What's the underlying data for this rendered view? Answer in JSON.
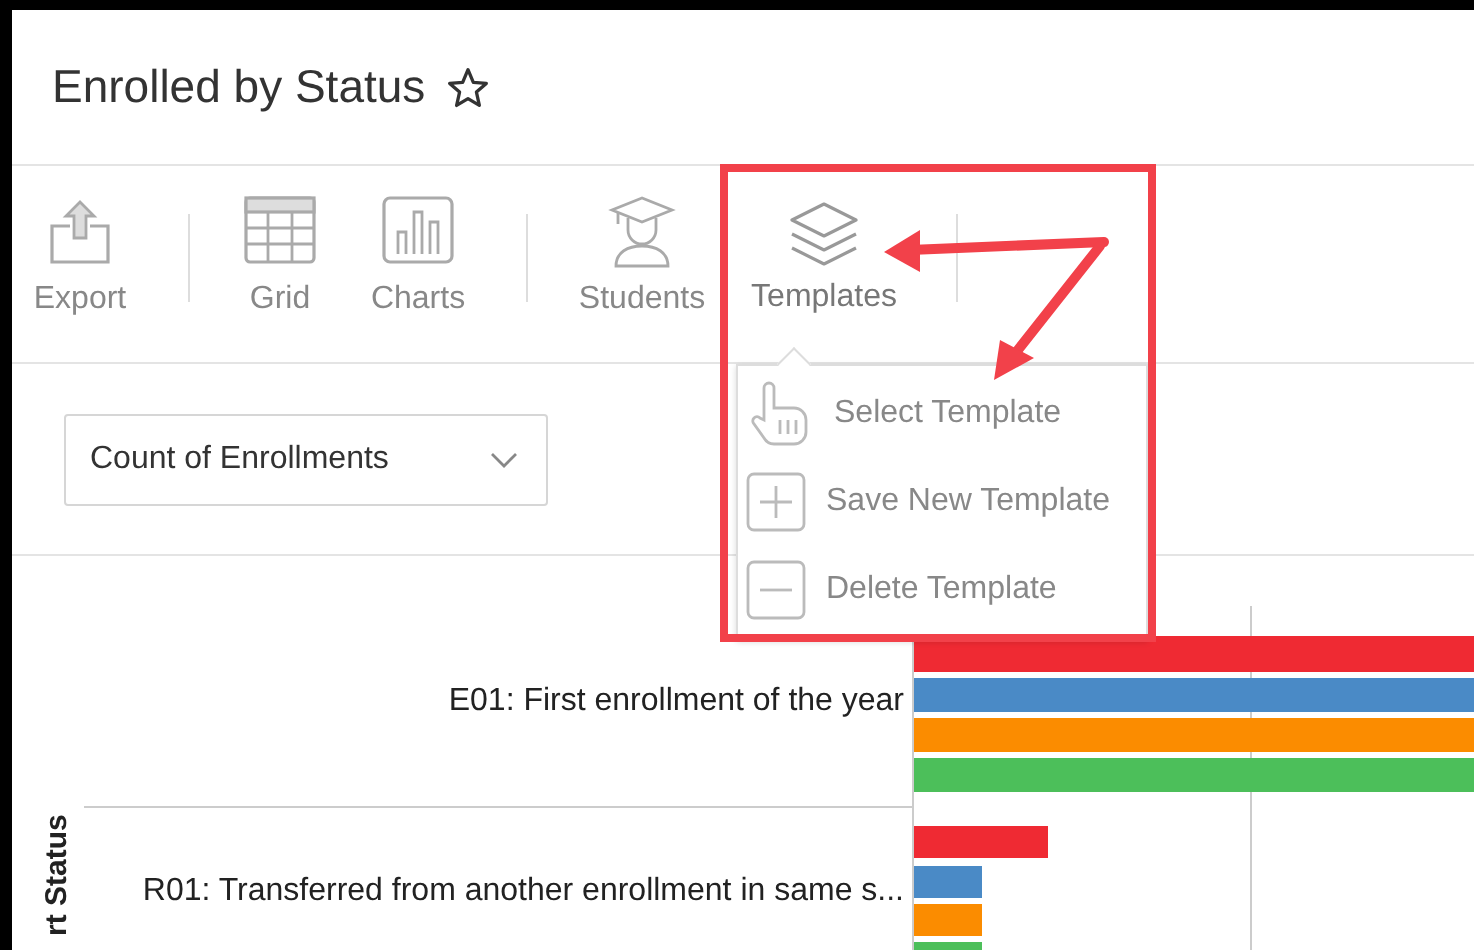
{
  "window": {
    "title": "Enrolled by Status",
    "favorite": false
  },
  "toolbar": [
    {
      "kind": "export",
      "label": "Export",
      "expanded": false
    },
    {
      "kind": "separator"
    },
    {
      "kind": "grid",
      "label": "Grid",
      "expanded": false
    },
    {
      "kind": "charts",
      "label": "Charts",
      "expanded": false
    },
    {
      "kind": "separator"
    },
    {
      "kind": "students",
      "label": "Students",
      "expanded": false
    },
    {
      "kind": "templates",
      "label": "Templates",
      "expanded": true
    },
    {
      "kind": "separator"
    }
  ],
  "templates_menu": [
    {
      "kind": "select",
      "label": "Select Template"
    },
    {
      "kind": "add",
      "label": "Save New Template"
    },
    {
      "kind": "remove",
      "label": "Delete Template"
    }
  ],
  "measure_dropdown": {
    "value": "Count of Enrollments"
  },
  "chart": {
    "axis_label": "rt Status",
    "categories": [
      "E01: First enrollment of the year",
      "R01: Transferred from another enrollment in same s..."
    ]
  }
}
